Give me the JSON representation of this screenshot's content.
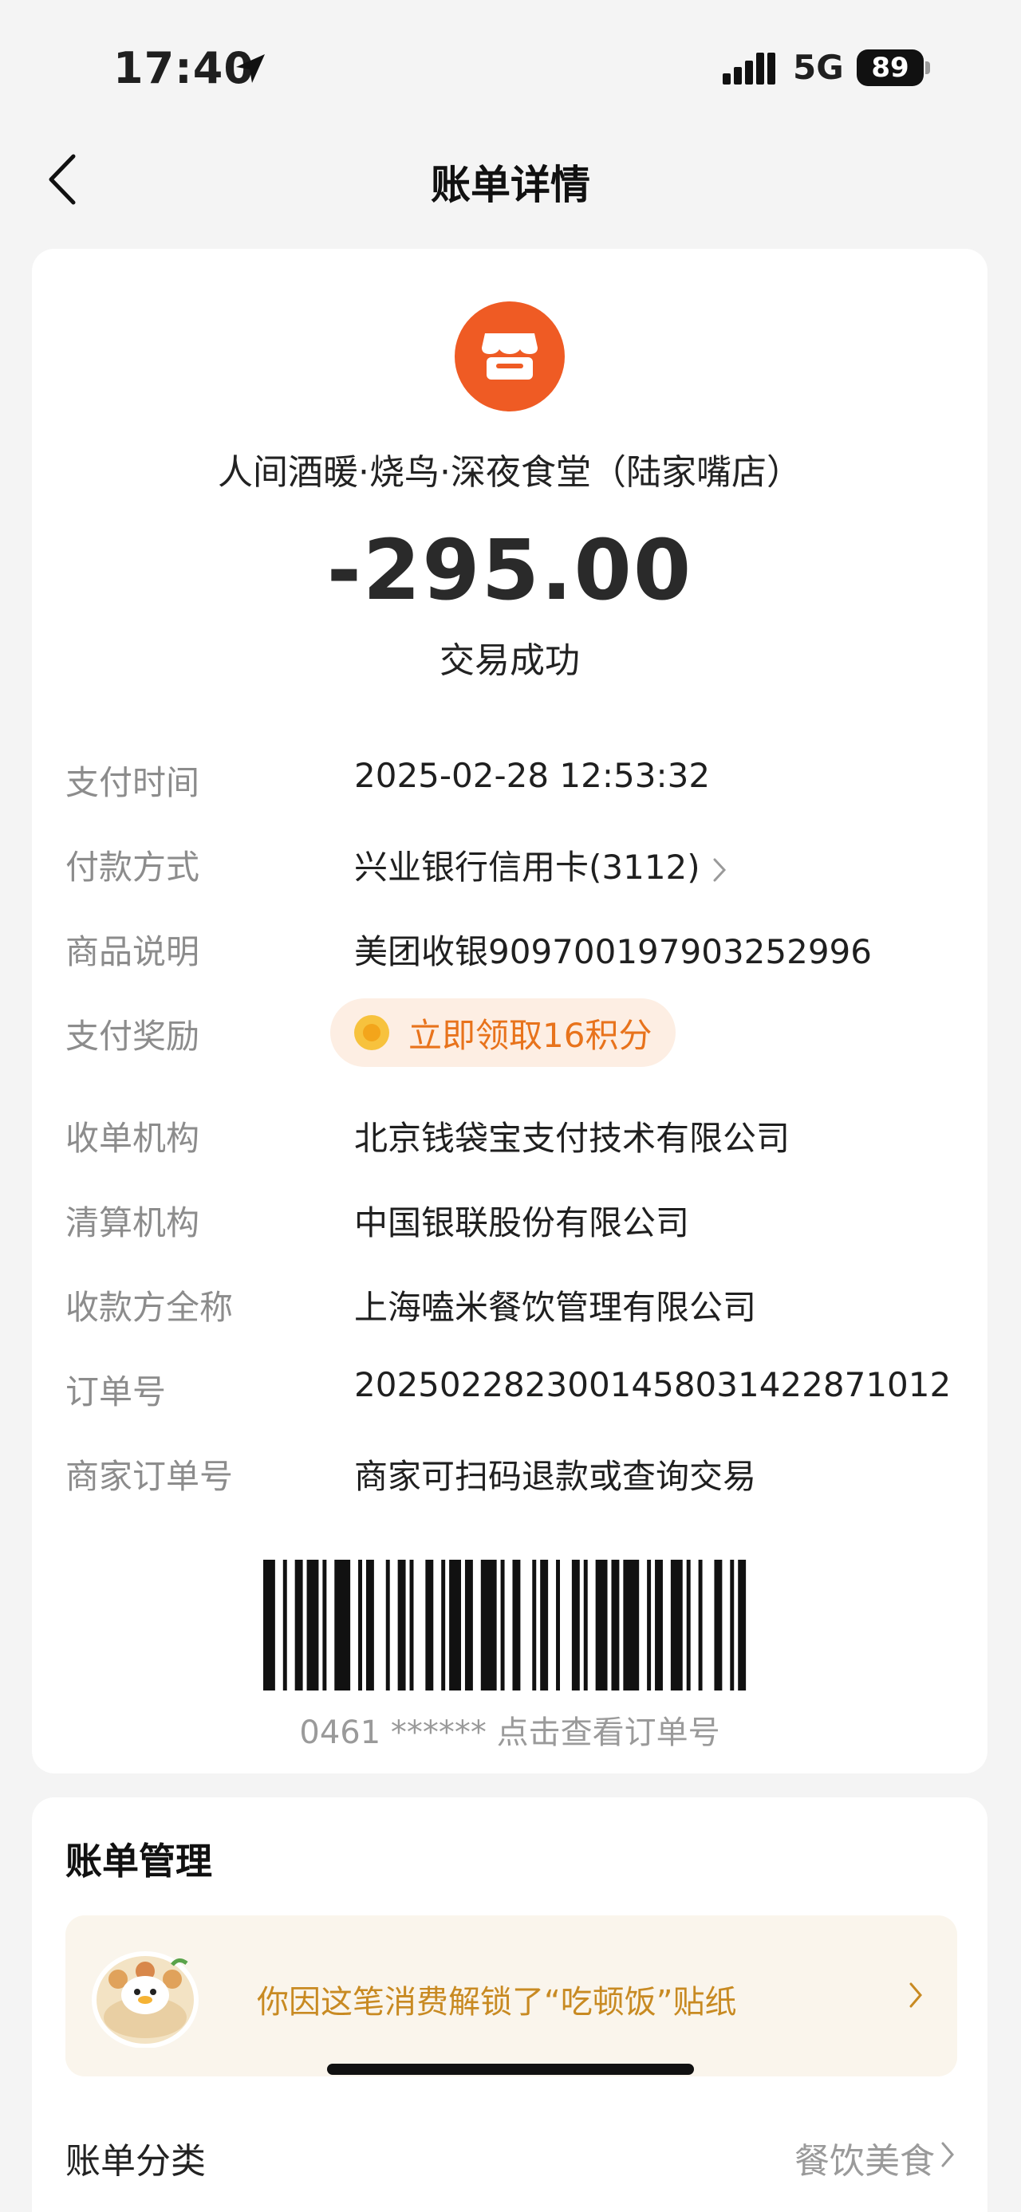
{
  "status_bar": {
    "time": "17:40",
    "network": "5G",
    "battery": "89",
    "icons": [
      "location-arrow-icon",
      "signal-icon",
      "battery-icon"
    ]
  },
  "nav": {
    "title": "账单详情",
    "back_icon": "chevron-left-icon"
  },
  "transaction": {
    "merchant_icon": "store-icon",
    "merchant_color": "#ef5b24",
    "merchant_name": "人间酒暖·烧鸟·深夜食堂（陆家嘴店）",
    "amount": "-295.00",
    "status": "交易成功"
  },
  "details": [
    {
      "label": "支付时间",
      "value": "2025-02-28 12:53:32"
    },
    {
      "label": "付款方式",
      "value": "兴业银行信用卡(3112)"
    },
    {
      "label": "商品说明",
      "value": "美团收银909700197903252996"
    },
    {
      "label": "支付奖励",
      "value": "立即领取16积分"
    },
    {
      "label": "收单机构",
      "value": "北京钱袋宝支付技术有限公司"
    },
    {
      "label": "清算机构",
      "value": "中国银联股份有限公司"
    },
    {
      "label": "收款方全称",
      "value": "上海嗑米餐饮管理有限公司"
    },
    {
      "label": "订单号",
      "value": "2025022823001458031422871012"
    },
    {
      "label": "商家订单号",
      "value": "商家可扫码退款或查询交易"
    }
  ],
  "barcode": {
    "caption": "0461 ****** 点击查看订单号"
  },
  "bill_management": {
    "title": "账单管理",
    "sticker_text": "你因这笔消费解锁了“吃顿饭”贴纸",
    "category_label": "账单分类",
    "category_value": "餐饮美食"
  },
  "colors": {
    "accent": "#ef5b24",
    "reward_text": "#e8731c",
    "sticker_text": "#c88a22"
  }
}
